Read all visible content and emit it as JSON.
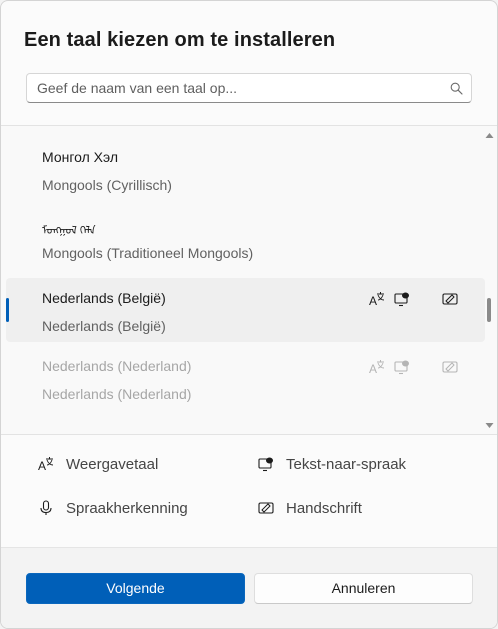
{
  "dialog": {
    "title": "Een taal kiezen om te installeren",
    "search": {
      "placeholder": "Geef de naam van een taal op...",
      "value": ""
    }
  },
  "languages": [
    {
      "name": "Монгол Хэл",
      "subtitle": "Mongools (Cyrillisch)",
      "selected": false,
      "disabled": false
    },
    {
      "name": "ᠮᠣᠩᠭᠣᠯ ᠬᠡᠯᠡ",
      "subtitle": "Mongools (Traditioneel Mongools)",
      "selected": false,
      "disabled": false
    },
    {
      "name": "Nederlands (België)",
      "subtitle": "Nederlands (België)",
      "selected": true,
      "disabled": false,
      "features": [
        "display-language-icon",
        "text-to-speech-icon",
        "handwriting-icon"
      ]
    },
    {
      "name": "Nederlands (Nederland)",
      "subtitle": "Nederlands (Nederland)",
      "selected": false,
      "disabled": true,
      "features": [
        "display-language-icon",
        "text-to-speech-icon",
        "handwriting-icon"
      ]
    }
  ],
  "legend": {
    "display_language": "Weergavetaal",
    "text_to_speech": "Tekst-naar-spraak",
    "speech_recognition": "Spraakherkenning",
    "handwriting": "Handschrift"
  },
  "buttons": {
    "next": "Volgende",
    "cancel": "Annuleren"
  },
  "colors": {
    "accent": "#005fb8",
    "text": "#1b1b1b",
    "subtext": "#616161",
    "disabled": "#a6a6a6"
  }
}
